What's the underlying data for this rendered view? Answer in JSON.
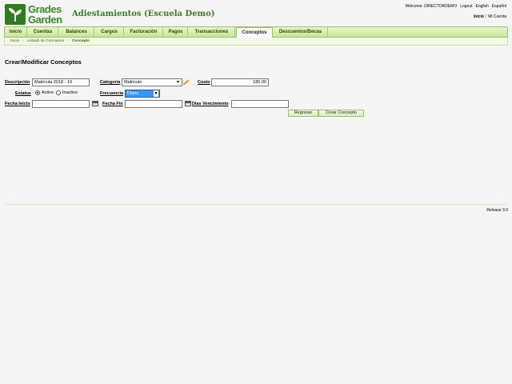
{
  "header": {
    "logo_line1": "Grades",
    "logo_line2": "Garden",
    "app_title": "Adiestamientos (Escuela Demo)",
    "welcome": "Welcome: DIRECTORDEMO",
    "logout": "Logout",
    "lang_en": "English",
    "lang_es": "Español",
    "home_link": "Inicio",
    "separator": "|",
    "account_link": "Mi Cuenta"
  },
  "nav": {
    "tabs": [
      {
        "label": "Inicio"
      },
      {
        "label": "Cuentas"
      },
      {
        "label": "Balances"
      },
      {
        "label": "Cargos"
      },
      {
        "label": "Facturación"
      },
      {
        "label": "Pagos"
      },
      {
        "label": "Transacciones"
      },
      {
        "label": "Conceptos"
      },
      {
        "label": "Descuentos/Becas"
      }
    ],
    "active": "Conceptos"
  },
  "breadcrumb": {
    "items": [
      "Inicio",
      "Listado de Conceptos",
      "Concepto"
    ],
    "arrow": "›"
  },
  "form": {
    "heading": "Crear/Modificar Conceptos",
    "descripcion_label": "Descripción",
    "descripcion_value": "Matricula 2018 - 19",
    "categoria_label": "Categoría",
    "categoria_value": "Matricule",
    "costo_label": "Costo",
    "costo_value": "180.00",
    "estatus_label": "Estatus",
    "activo_label": "Activo",
    "inactivo_label": "Inactivo",
    "frecuencia_label": "Frecuencia",
    "frecuencia_value": "Diario",
    "fecha_inicio_label": "Fecha Inicio",
    "fecha_fin_label": "Fecha Fin",
    "dias_vencimiento_label": "Dias Vencimiento",
    "regresar_button": "Regresar",
    "crear_button": "Crear Concepto"
  },
  "footer": {
    "release": "Release 3.0"
  },
  "icons": {
    "logo": "plant-logo-icon",
    "calendar": "calendar-icon",
    "edit": "pencil-icon",
    "dropdown": "chevron-down-icon"
  },
  "colors": {
    "brand_green": "#3c8a2a",
    "nav_green": "#c7e699",
    "select_highlight": "#3399ff"
  }
}
